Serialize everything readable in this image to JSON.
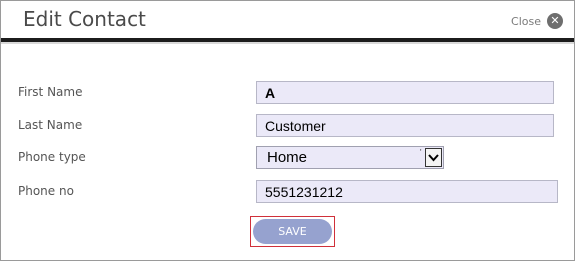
{
  "dialog": {
    "title": "Edit Contact",
    "close_label": "Close",
    "close_icon": "close-icon"
  },
  "form": {
    "first_name": {
      "label": "First Name",
      "value": "A"
    },
    "last_name": {
      "label": "Last Name",
      "value": "Customer"
    },
    "phone_type": {
      "label": "Phone type",
      "selected": "Home",
      "tick": "'"
    },
    "phone_no": {
      "label": "Phone no",
      "value": "5551231212"
    }
  },
  "actions": {
    "save_label": "SAVE"
  },
  "colors": {
    "field_bg": "#ebe9f8",
    "save_bg": "#96a2cf",
    "save_outline": "#d0303a",
    "header_rule": "#1c1c1c"
  }
}
